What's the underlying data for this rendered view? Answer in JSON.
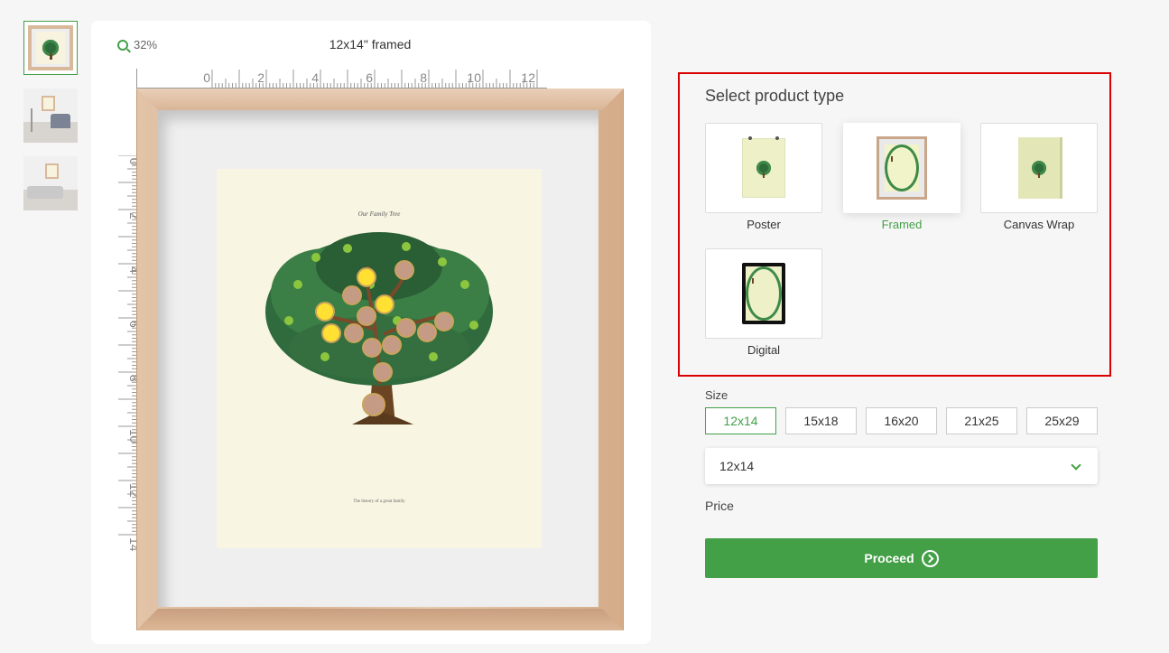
{
  "preview": {
    "zoom_level": "32%",
    "size_title": "12x14\" framed",
    "ruler_h_labels": [
      "0",
      "2",
      "4",
      "6",
      "8",
      "10",
      "12"
    ],
    "ruler_v_labels": [
      "0",
      "2",
      "4",
      "6",
      "8",
      "10",
      "12",
      "14"
    ],
    "artwork": {
      "title": "Our Family Tree",
      "subtitle": "The history of a great family"
    }
  },
  "thumbnails": [
    {
      "name": "framed-view"
    },
    {
      "name": "room-view-chair"
    },
    {
      "name": "room-view-sofa"
    }
  ],
  "product_type": {
    "title": "Select product type",
    "options": [
      {
        "label": "Poster",
        "selected": false
      },
      {
        "label": "Framed",
        "selected": true
      },
      {
        "label": "Canvas Wrap",
        "selected": false
      },
      {
        "label": "Digital",
        "selected": false
      }
    ]
  },
  "size": {
    "label": "Size",
    "options": [
      "12x14",
      "15x18",
      "16x20",
      "21x25",
      "25x29"
    ],
    "selected": "12x14",
    "dropdown_value": "12x14"
  },
  "price": {
    "label": "Price"
  },
  "proceed_label": "Proceed",
  "colors": {
    "accent": "#43a047",
    "highlight_border": "#d80000",
    "frame_wood": "#d8b08f"
  }
}
